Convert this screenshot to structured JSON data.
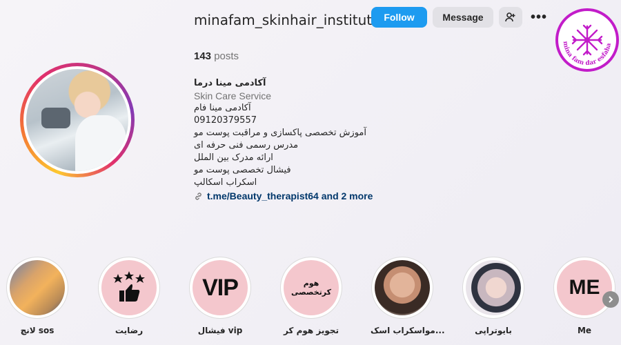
{
  "header": {
    "username": "minafam_skinhair_institute",
    "follow_label": "Follow",
    "message_label": "Message",
    "add_user_icon": "add-user-icon",
    "more_icon": "more-horizontal-icon",
    "more_glyph": "•••",
    "logo_text": "mina fam dar esfahan"
  },
  "stats": {
    "posts_count": "143",
    "posts_label": "posts"
  },
  "bio": {
    "name": "آکادمی مینا درما",
    "category": "Skin Care Service",
    "lines": [
      "آکادمی مینا فام",
      "09120379557",
      "آموزش تخصصی پاکسازی و مراقبت پوست مو",
      "مدرس رسمی فنی حرفه ای",
      "ارائه مدرک بین الملل",
      "فیشال تخصصی پوست مو",
      "اسکراب اسکالپ"
    ],
    "link_text": "t.me/Beauty_therapist64 and 2 more",
    "link_icon": "link-icon"
  },
  "highlights": [
    {
      "label": "لانچ sos",
      "kind": "photo1",
      "text": ""
    },
    {
      "label": "رضایت",
      "kind": "icon",
      "text": ""
    },
    {
      "label": "فیشال vip",
      "kind": "vip",
      "text": "VIP"
    },
    {
      "label": "تجویز هوم کر",
      "kind": "hc",
      "text": "هوم کرتخصصی"
    },
    {
      "label": "مواسکراب اسک...",
      "kind": "photo2",
      "text": ""
    },
    {
      "label": "بایوتراپی",
      "kind": "photo3",
      "text": ""
    },
    {
      "label": "Me",
      "kind": "me",
      "text": "ME"
    }
  ],
  "scroll_next_icon": "chevron-right-icon",
  "colors": {
    "follow_bg": "#1d9bf0",
    "highlight_bg": "#f4c7cd",
    "link": "#00376b"
  }
}
